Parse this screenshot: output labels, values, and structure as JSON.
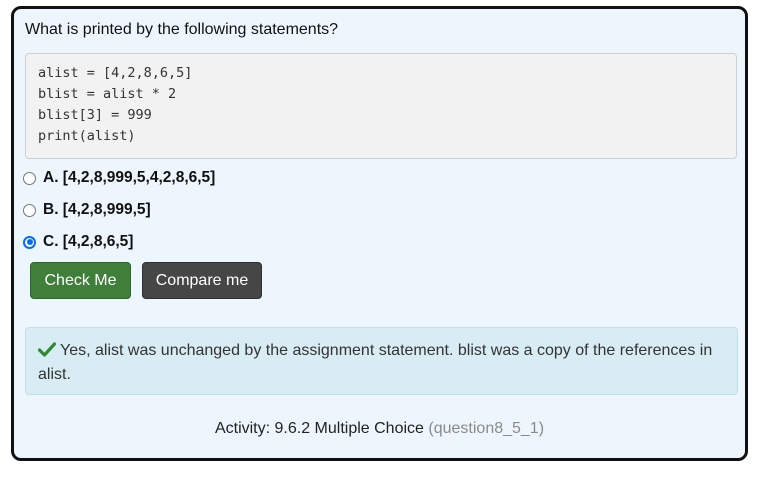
{
  "question": {
    "prompt": "What is printed by the following statements?"
  },
  "code": {
    "lines": [
      "alist = [4,2,8,6,5]",
      "blist = alist * 2",
      "blist[3] = 999",
      "print(alist)"
    ]
  },
  "options": [
    {
      "label": "A. [4,2,8,999,5,4,2,8,6,5]",
      "selected": false
    },
    {
      "label": "B. [4,2,8,999,5]",
      "selected": false
    },
    {
      "label": "C. [4,2,8,6,5]",
      "selected": true
    }
  ],
  "buttons": {
    "check_label": "Check Me",
    "compare_label": "Compare me"
  },
  "feedback": {
    "icon": "check-icon",
    "text": "Yes, alist was unchanged by the assignment statement. blist was a copy of the references in alist."
  },
  "activity": {
    "label": "Activity: 9.6.2 Multiple Choice",
    "id": "(question8_5_1)"
  },
  "colors": {
    "card_background": "#eef6fd",
    "check_button": "#3f7f3a",
    "compare_button": "#464646",
    "feedback_background": "#d8ecf3",
    "check_icon": "#2f8a2f",
    "radio_selected": "#0a6cf0"
  }
}
